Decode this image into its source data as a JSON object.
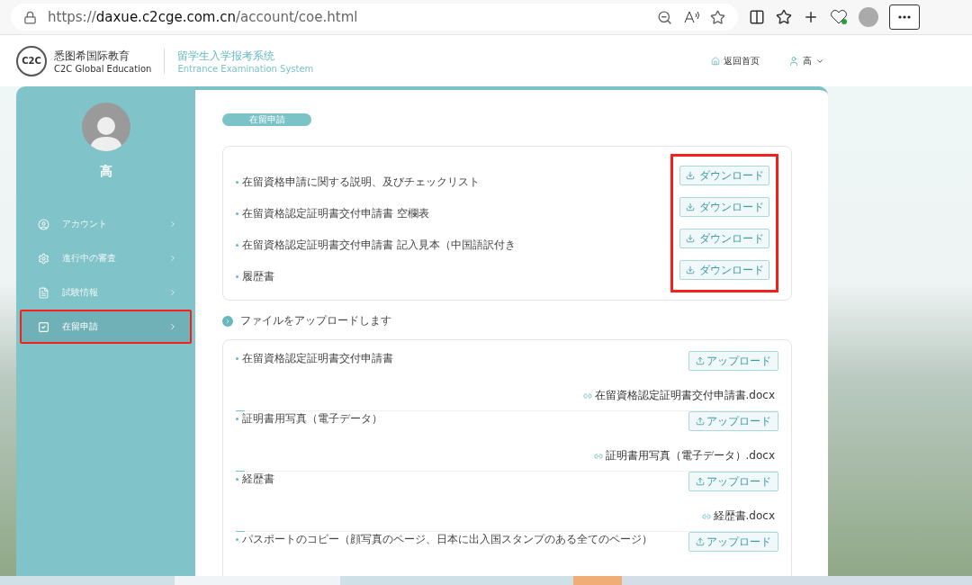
{
  "browser": {
    "url_prefix": "https://",
    "url_host": "daxue.c2cge.com.cn",
    "url_path": "/account/coe.html"
  },
  "header": {
    "logo_mark": "C2C",
    "brand_cn": "悉图希国际教育",
    "brand_en": "C2C Global Education",
    "system_cn": "留学生入学报考系统",
    "system_en": "Entrance Examination System",
    "home_link": "返回首页",
    "user": "高"
  },
  "sidebar": {
    "name": "高",
    "items": [
      {
        "label": "アカウント",
        "selected": false,
        "highlighted": false
      },
      {
        "label": "進行中の審査",
        "selected": false,
        "highlighted": false
      },
      {
        "label": "試験情報",
        "selected": false,
        "highlighted": false
      },
      {
        "label": "在留申請",
        "selected": true,
        "highlighted": true
      }
    ]
  },
  "tab": "在留申請",
  "downloads": {
    "highlighted": true,
    "items": [
      {
        "label": "在留資格申請に関する説明、及びチェックリスト",
        "button": "ダウンロード"
      },
      {
        "label": "在留資格認定証明書交付申請書 空欄表",
        "button": "ダウンロード"
      },
      {
        "label": "在留資格認定証明書交付申請書 記入見本（中国語訳付き",
        "button": "ダウンロード"
      },
      {
        "label": "履歴書",
        "button": "ダウンロード"
      }
    ]
  },
  "upload_title": "ファイルをアップロードします",
  "uploads": [
    {
      "label": "在留資格認定証明書交付申請書",
      "button": "アップロード",
      "file": "在留資格認定証明書交付申請書.docx"
    },
    {
      "label": "証明書用写真（電子データ）",
      "button": "アップロード",
      "file": "証明書用写真（電子データ）.docx"
    },
    {
      "label": "経歴書",
      "button": "アップロード",
      "file": "経歴書.docx"
    },
    {
      "label": "パスポートのコピー（顔写真のページ、日本に出入国スタンプのある全てのページ）",
      "button": "アップロード"
    }
  ]
}
